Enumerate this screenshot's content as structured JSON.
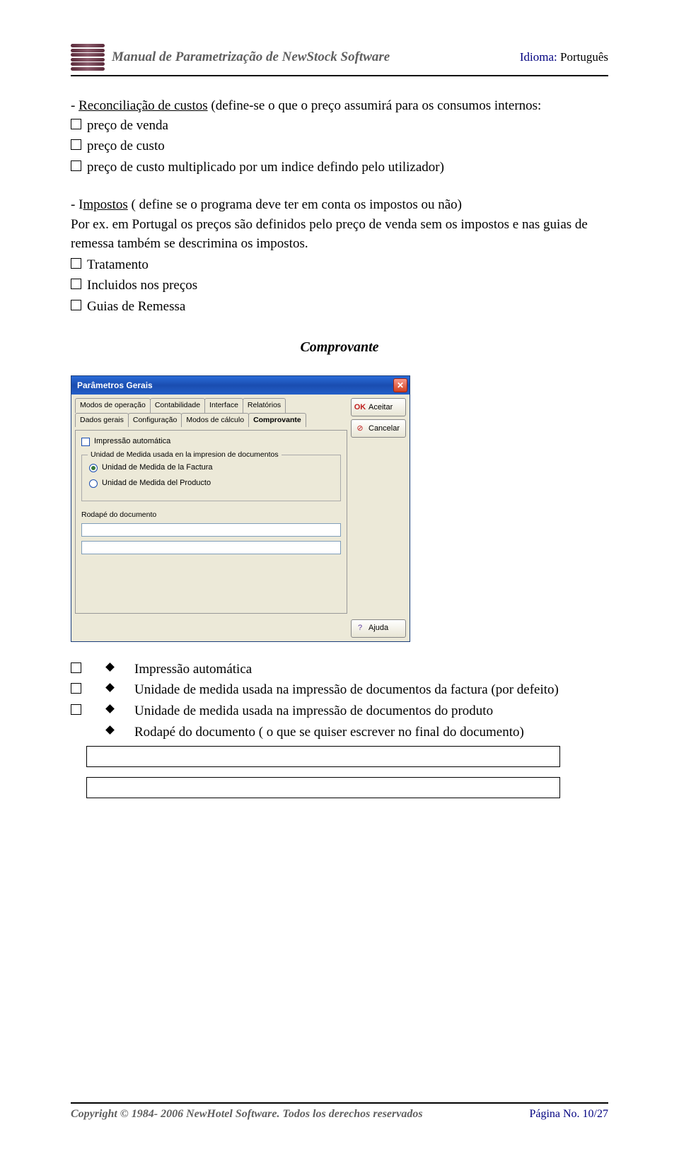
{
  "header": {
    "doc_title": "Manual de Parametrização de NewStock Software",
    "lang_label": "Idioma:",
    "lang_value": "Português"
  },
  "body": {
    "reconc_intro_a": "- ",
    "reconc_underlined": "Reconciliação de custos",
    "reconc_intro_b": " (define-se o que o preço assumirá  para os consumos internos:",
    "opt1": "preço de venda",
    "opt2": "preço de custo",
    "opt3": "preço de custo multiplicado por um indice defindo pelo utilizador)",
    "impostos_a": "- I",
    "impostos_underlined": "mpostos",
    "impostos_b": " ( define se o programa deve ter em conta os impostos ou não)",
    "impostos_line2": "Por ex. em Portugal os preços são definidos pelo preço de venda  sem os impostos e nas guias de remessa também se descrimina os impostos.",
    "opt4": "Tratamento",
    "opt5": "Incluidos nos preços",
    "opt6": "Guias de Remessa",
    "section_title": "Comprovante"
  },
  "dialog": {
    "title": "Parâmetros Gerais",
    "tabs_row1": [
      "Modos de operação",
      "Contabilidade",
      "Interface",
      "Relatórios"
    ],
    "tabs_row2": [
      "Dados gerais",
      "Configuração",
      "Modos de cálculo",
      "Comprovante"
    ],
    "active_tab": "Comprovante",
    "chk_auto": "Impressão automática",
    "group_label": "Unidad de Medida usada en la impresion de documentos",
    "radio1": "Unidad de Medida de la Factura",
    "radio2": "Unidad de Medida del Producto",
    "rodape_label": "Rodapé do documento",
    "input1": "",
    "input2": "",
    "btn_ok": "Aceitar",
    "btn_cancel": "Cancelar",
    "btn_help": "Ajuda"
  },
  "bullets": {
    "b1": "Impressão automática",
    "b2": "Unidade de medida usada na impressão de documentos da factura (por defeito)",
    "b3": "Unidade de medida usada na impressão de documentos do produto",
    "b4": "Rodapé do documento ( o que se quiser escrever no final do documento)"
  },
  "footer": {
    "copyright": "Copyright © 1984- 2006 NewHotel Software. Todos los derechos reservados",
    "page": "Página No. 10/27"
  }
}
